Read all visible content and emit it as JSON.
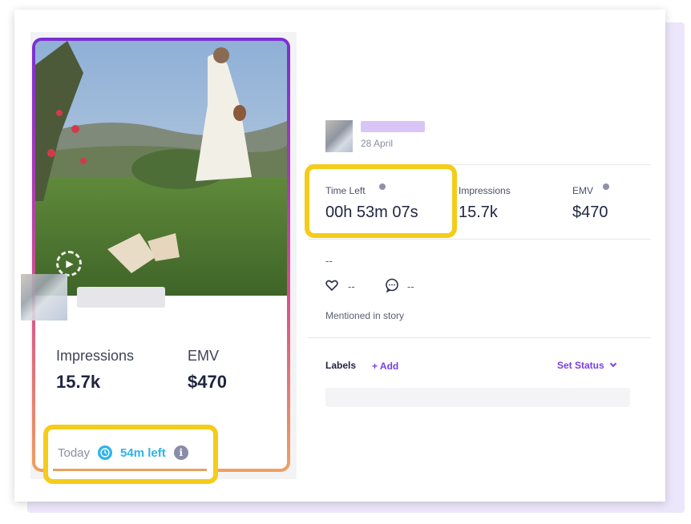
{
  "card": {
    "impressions_label": "Impressions",
    "impressions_value": "15.7k",
    "emv_label": "EMV",
    "emv_value": "$470",
    "today_label": "Today",
    "time_left": "54m left",
    "info_glyph": "i"
  },
  "detail": {
    "date": "28 April",
    "time_left_label": "Time Left",
    "time_left_value": "00h 53m 07s",
    "impressions_label": "Impressions",
    "impressions_value": "15.7k",
    "emv_label": "EMV",
    "emv_value": "$470",
    "caption": "--",
    "likes": "--",
    "comments": "--",
    "mentioned": "Mentioned in story"
  },
  "labels_section": {
    "labels": "Labels",
    "add": "+ Add",
    "set_status": "Set Status"
  },
  "icons": {
    "play": "play-icon",
    "clock": "clock-icon",
    "info": "info-icon",
    "heart": "heart-icon",
    "comment": "comment-icon",
    "chevron": "chevron-down-icon"
  },
  "colors": {
    "accent": "#7a3ee6",
    "highlight": "#f4cc1a",
    "timer": "#2eb3ea"
  }
}
